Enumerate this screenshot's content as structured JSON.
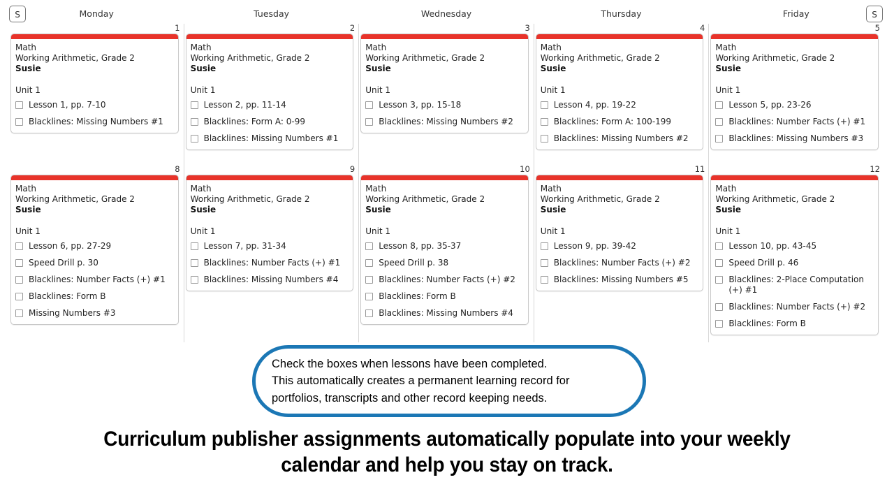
{
  "toolbar": {
    "saturday_label": "S",
    "sunday_label": "S"
  },
  "colors": {
    "card_accent": "#e8332a",
    "callout_border": "#1b77b5",
    "card_border": "#c9c9c9",
    "column_divider": "#d8d8d8"
  },
  "calendar": {
    "days": [
      {
        "label": "Monday"
      },
      {
        "label": "Tuesday"
      },
      {
        "label": "Wednesday"
      },
      {
        "label": "Thursday"
      },
      {
        "label": "Friday"
      }
    ],
    "weeks": [
      {
        "cells": [
          {
            "daynum": "1",
            "subject": "Math",
            "course": "Working Arithmetic, Grade 2",
            "student": "Susie",
            "unit": "Unit 1",
            "tasks": [
              "Lesson 1, pp. 7-10",
              "Blacklines: Missing Numbers #1"
            ]
          },
          {
            "daynum": "2",
            "subject": "Math",
            "course": "Working Arithmetic, Grade 2",
            "student": "Susie",
            "unit": "Unit 1",
            "tasks": [
              "Lesson 2, pp. 11-14",
              "Blacklines: Form A: 0-99",
              "Blacklines: Missing Numbers #1"
            ]
          },
          {
            "daynum": "3",
            "subject": "Math",
            "course": "Working Arithmetic, Grade 2",
            "student": "Susie",
            "unit": "Unit 1",
            "tasks": [
              "Lesson 3, pp. 15-18",
              "Blacklines: Missing Numbers #2"
            ]
          },
          {
            "daynum": "4",
            "subject": "Math",
            "course": "Working Arithmetic, Grade 2",
            "student": "Susie",
            "unit": "Unit 1",
            "tasks": [
              "Lesson 4, pp. 19-22",
              "Blacklines: Form A: 100-199",
              "Blacklines: Missing Numbers #2"
            ]
          },
          {
            "daynum": "5",
            "subject": "Math",
            "course": "Working Arithmetic, Grade 2",
            "student": "Susie",
            "unit": "Unit 1",
            "tasks": [
              "Lesson 5, pp. 23-26",
              "Blacklines: Number Facts (+) #1",
              "Blacklines: Missing Numbers #3"
            ]
          }
        ]
      },
      {
        "cells": [
          {
            "daynum": "8",
            "subject": "Math",
            "course": "Working Arithmetic, Grade 2",
            "student": "Susie",
            "unit": "Unit 1",
            "tasks": [
              "Lesson 6, pp. 27-29",
              "Speed Drill p. 30",
              "Blacklines: Number Facts (+) #1",
              "Blacklines: Form B",
              "Missing Numbers #3"
            ]
          },
          {
            "daynum": "9",
            "subject": "Math",
            "course": "Working Arithmetic, Grade 2",
            "student": "Susie",
            "unit": "Unit 1",
            "tasks": [
              "Lesson 7, pp. 31-34",
              "Blacklines: Number Facts (+) #1",
              "Blacklines: Missing Numbers #4"
            ]
          },
          {
            "daynum": "10",
            "subject": "Math",
            "course": "Working Arithmetic, Grade 2",
            "student": "Susie",
            "unit": "Unit 1",
            "tasks": [
              "Lesson 8, pp. 35-37",
              "Speed Drill p. 38",
              "Blacklines: Number Facts (+) #2",
              "Blacklines: Form B",
              "Blacklines: Missing Numbers #4"
            ]
          },
          {
            "daynum": "11",
            "subject": "Math",
            "course": "Working Arithmetic, Grade 2",
            "student": "Susie",
            "unit": "Unit 1",
            "tasks": [
              "Lesson 9, pp. 39-42",
              "Blacklines: Number Facts (+) #2",
              "Blacklines: Missing Numbers #5"
            ]
          },
          {
            "daynum": "12",
            "subject": "Math",
            "course": "Working Arithmetic, Grade 2",
            "student": "Susie",
            "unit": "Unit 1",
            "tasks": [
              "Lesson 10, pp. 43-45",
              "Speed Drill p. 46",
              "Blacklines: 2-Place Computation (+) #1",
              "Blacklines: Number Facts (+) #2",
              "Blacklines: Form B"
            ]
          }
        ]
      }
    ]
  },
  "callout": {
    "text": "Check the boxes when lessons have been completed.\nThis automatically creates a permanent learning record for\nportfolios, transcripts and other record keeping needs."
  },
  "caption": {
    "text": "Curriculum publisher assignments automatically populate into your weekly\ncalendar and help you stay on track."
  }
}
